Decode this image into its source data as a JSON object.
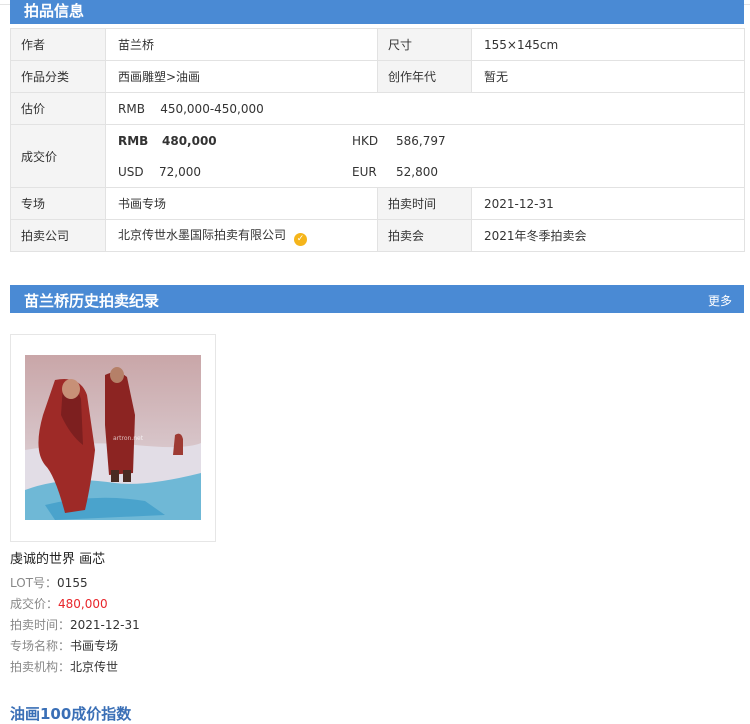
{
  "info_section": {
    "title": "拍品信息"
  },
  "info_rows": {
    "author_label": "作者",
    "author_value": "苗兰桥",
    "size_label": "尺寸",
    "size_value": "155×145cm",
    "category_label": "作品分类",
    "category_value": "西画雕塑>油画",
    "year_label": "创作年代",
    "year_value": "暂无",
    "estimate_label": "估价",
    "estimate_currency": "RMB",
    "estimate_value": "450,000-450,000",
    "deal_label": "成交价",
    "deal_rmb_currency": "RMB",
    "deal_rmb_value": "480,000",
    "deal_hkd_currency": "HKD",
    "deal_hkd_value": "586,797",
    "deal_usd_currency": "USD",
    "deal_usd_value": "72,000",
    "deal_eur_currency": "EUR",
    "deal_eur_value": "52,800",
    "session_label": "专场",
    "session_value": "书画专场",
    "auction_time_label": "拍卖时间",
    "auction_time_value": "2021-12-31",
    "company_label": "拍卖公司",
    "company_value": "北京传世水墨国际拍卖有限公司",
    "auction_event_label": "拍卖会",
    "auction_event_value": "2021年冬季拍卖会"
  },
  "history_section": {
    "title": "苗兰桥历史拍卖纪录",
    "more": "更多"
  },
  "lot_card": {
    "title": "虔诚的世界 画芯",
    "lot_key": "LOT号：",
    "lot_value": "0155",
    "price_key": "成交价：",
    "price_value": "480,000",
    "time_key": "拍卖时间：",
    "time_value": "2021-12-31",
    "session_key": "专场名称：",
    "session_value": "书画专场",
    "org_key": "拍卖机构：",
    "org_value": "北京传世"
  },
  "index_section": {
    "title": "油画100成价指数"
  },
  "colors": {
    "accent": "#4a8ad4",
    "price_red": "#e8262b",
    "label_bg": "#f4f4f4"
  },
  "icons": {
    "verified": "verified-badge-icon"
  }
}
